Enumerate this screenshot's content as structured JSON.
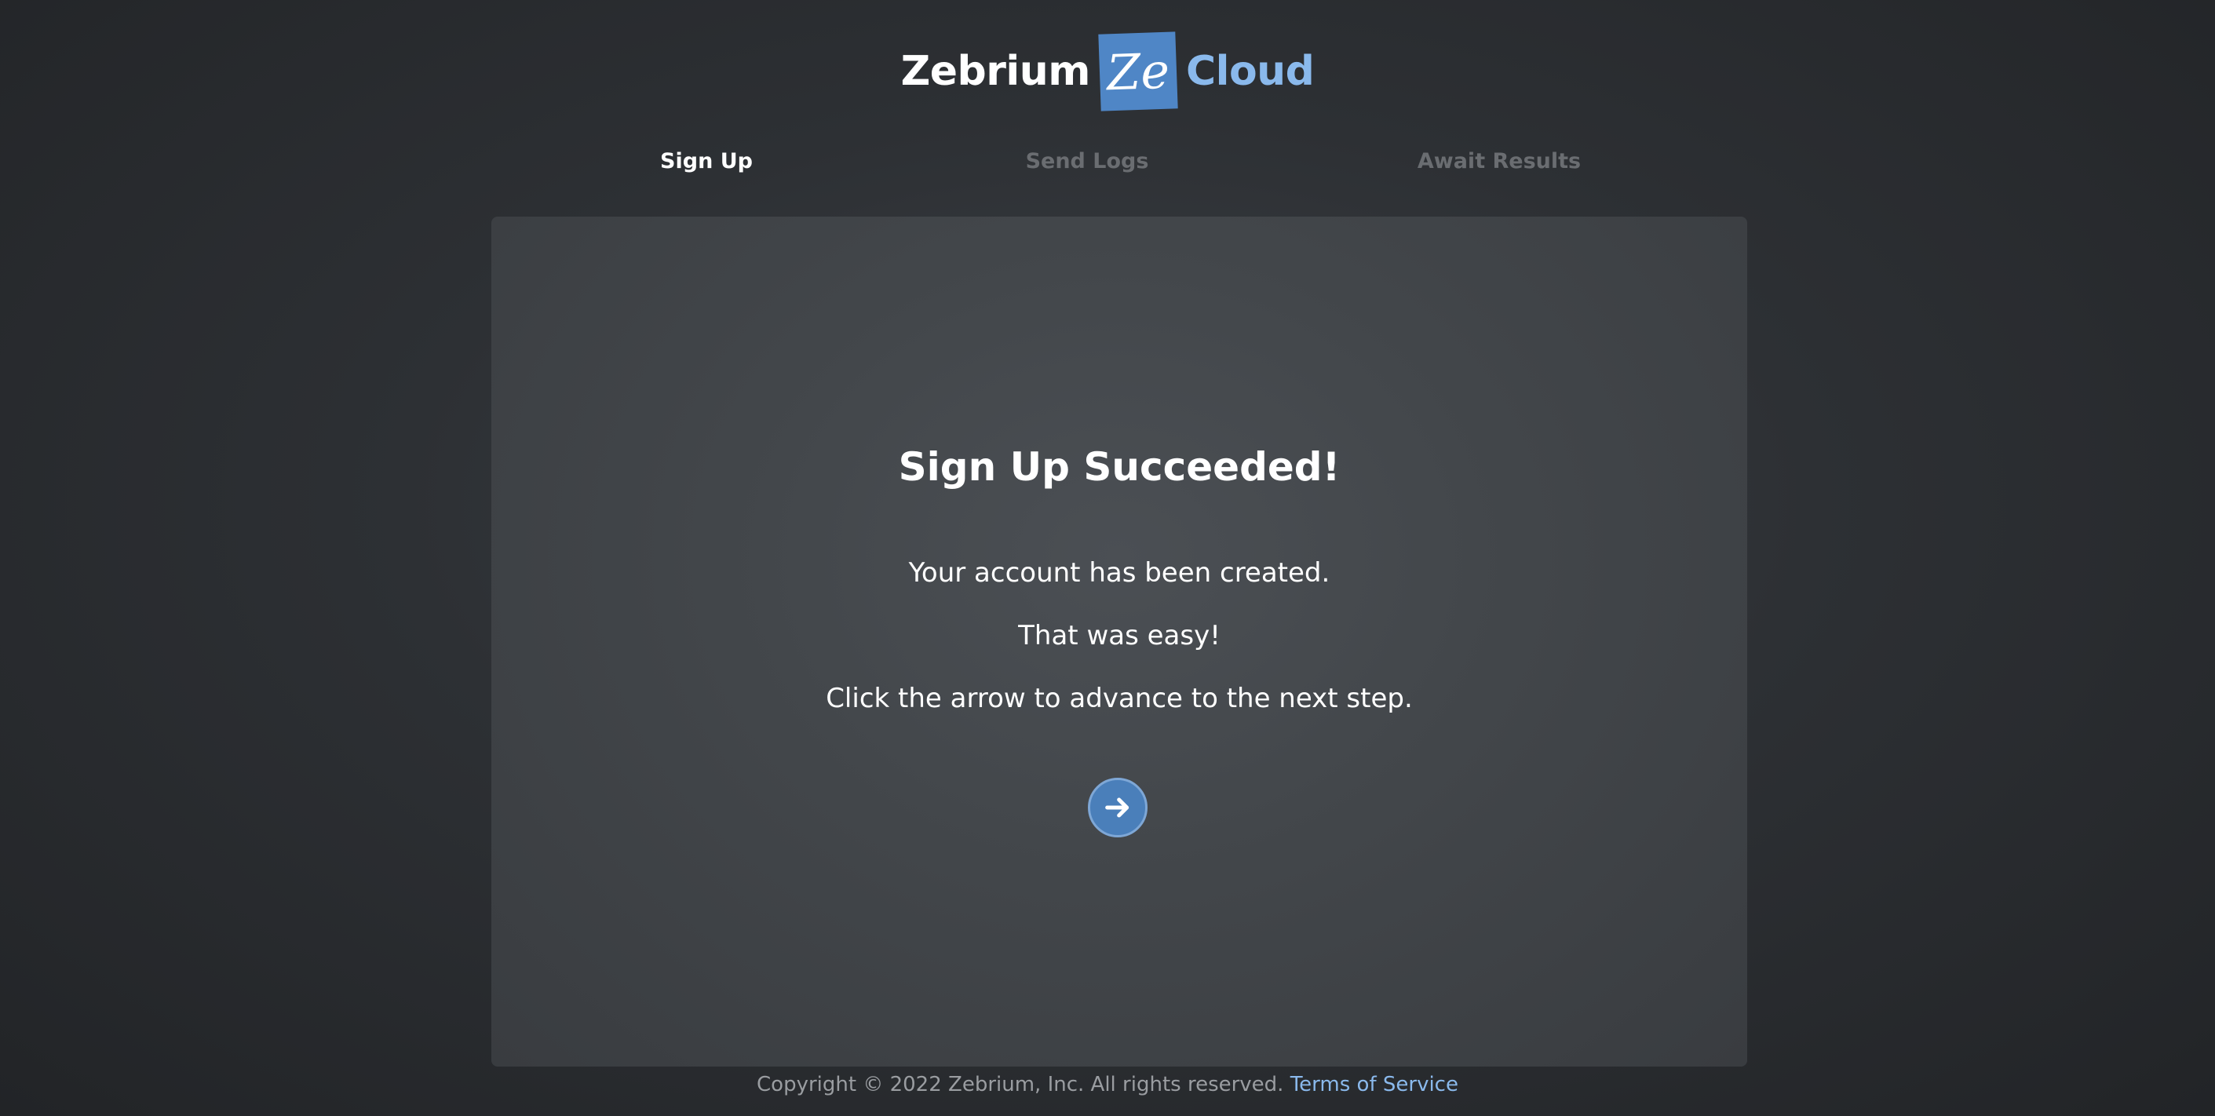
{
  "logo": {
    "word": "Zebrium",
    "mark": "Ze",
    "suffix": "Cloud",
    "mark_color": "#4f86c6",
    "suffix_color": "#8ab9ec"
  },
  "steps": [
    {
      "label": "Sign Up",
      "state": "active"
    },
    {
      "label": "Send Logs",
      "state": "inactive"
    },
    {
      "label": "Await Results",
      "state": "inactive"
    }
  ],
  "card": {
    "title": "Sign Up Succeeded!",
    "line1": "Your account has been created.",
    "line2": "That was easy!",
    "line3": "Click the arrow to advance to the next step.",
    "next_icon": "arrow-right-icon",
    "button_color": "#4a7fba"
  },
  "footer": {
    "copyright": "Copyright © 2022 Zebrium, Inc.  All rights reserved.",
    "terms_link": "Terms of Service",
    "link_color": "#8ab9ec"
  }
}
